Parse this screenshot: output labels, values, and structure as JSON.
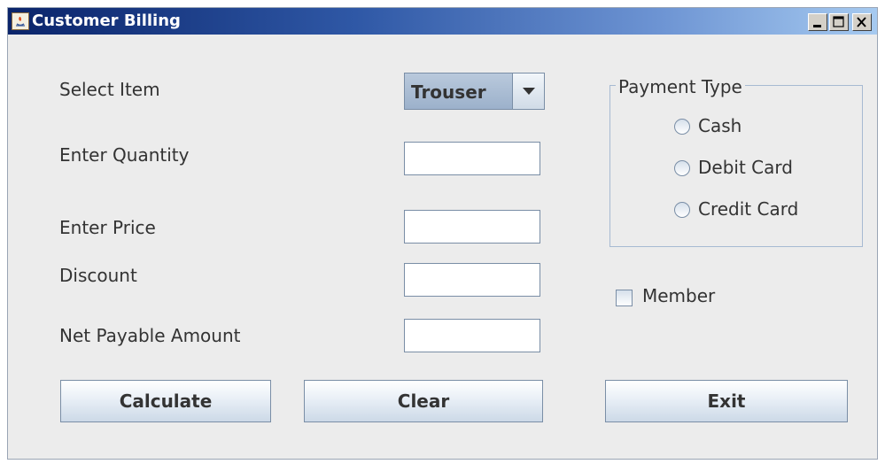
{
  "window": {
    "title": "Customer Billing",
    "controls": [
      "minimize-icon",
      "maximize-icon",
      "close-icon"
    ]
  },
  "form": {
    "select_item_label": "Select Item",
    "select_item_value": "Trouser",
    "quantity_label": "Enter Quantity",
    "quantity_value": "",
    "price_label": "Enter Price",
    "price_value": "",
    "discount_label": "Discount",
    "discount_value": "",
    "net_amount_label": "Net Payable Amount",
    "net_amount_value": ""
  },
  "payment": {
    "group_title": "Payment Type",
    "options": [
      {
        "label": "Cash",
        "selected": false
      },
      {
        "label": "Debit Card",
        "selected": false
      },
      {
        "label": "Credit Card",
        "selected": false
      }
    ]
  },
  "member": {
    "label": "Member",
    "checked": false
  },
  "buttons": {
    "calculate": "Calculate",
    "clear": "Clear",
    "exit": "Exit"
  },
  "colors": {
    "titlebar_start": "#0a246a",
    "titlebar_end": "#a6caf0",
    "window_bg": "#ececec",
    "control_border": "#7a8ea6",
    "groupbox_border": "#a7bad2"
  }
}
